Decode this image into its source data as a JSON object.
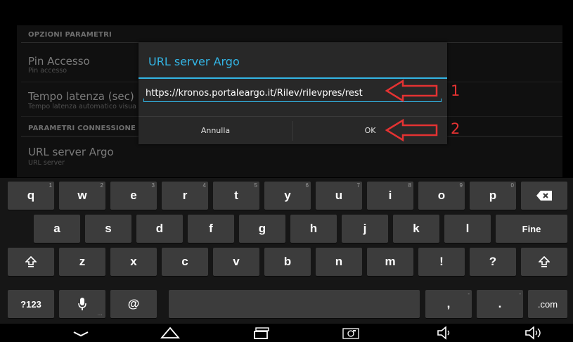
{
  "settings": {
    "section1": "OPZIONI PARAMETRI",
    "pin_title": "Pin Accesso",
    "pin_sub": "Pin accesso",
    "latency_title": "Tempo latenza (sec)",
    "latency_sub": "Tempo latenza automatico visua",
    "section2": "PARAMETRI CONNESSIONE",
    "url_title": "URL server Argo",
    "url_sub": "URL server"
  },
  "dialog": {
    "title": "URL server Argo",
    "url_value": "https://kronos.portaleargo.it/Rilev/rilevpres/rest",
    "cancel_label": "Annulla",
    "ok_label": "OK"
  },
  "annotations": {
    "one": "1",
    "two": "2"
  },
  "keyboard": {
    "row1": [
      {
        "label": "q",
        "hint": "1"
      },
      {
        "label": "w",
        "hint": "2"
      },
      {
        "label": "e",
        "hint": "3"
      },
      {
        "label": "r",
        "hint": "4"
      },
      {
        "label": "t",
        "hint": "5"
      },
      {
        "label": "y",
        "hint": "6"
      },
      {
        "label": "u",
        "hint": "7"
      },
      {
        "label": "i",
        "hint": "8"
      },
      {
        "label": "o",
        "hint": "9"
      },
      {
        "label": "p",
        "hint": "0"
      }
    ],
    "row2": [
      "a",
      "s",
      "d",
      "f",
      "g",
      "h",
      "j",
      "k",
      "l"
    ],
    "row3": [
      "z",
      "x",
      "c",
      "v",
      "b",
      "n",
      "m",
      "!",
      "?"
    ],
    "done_label": "Fine",
    "sym_label": "?123",
    "at_label": "@",
    "comma_label": ",",
    "dash_label": "-",
    "period_label": ".",
    "dotcom_label": ".com"
  },
  "colors": {
    "accent": "#33b5e5",
    "annotation": "#e33232"
  },
  "icons": [
    "backspace-icon",
    "shift-icon",
    "mic-icon",
    "back-icon",
    "home-icon",
    "recents-icon",
    "screenshot-icon",
    "volume-down-icon",
    "volume-up-icon"
  ]
}
